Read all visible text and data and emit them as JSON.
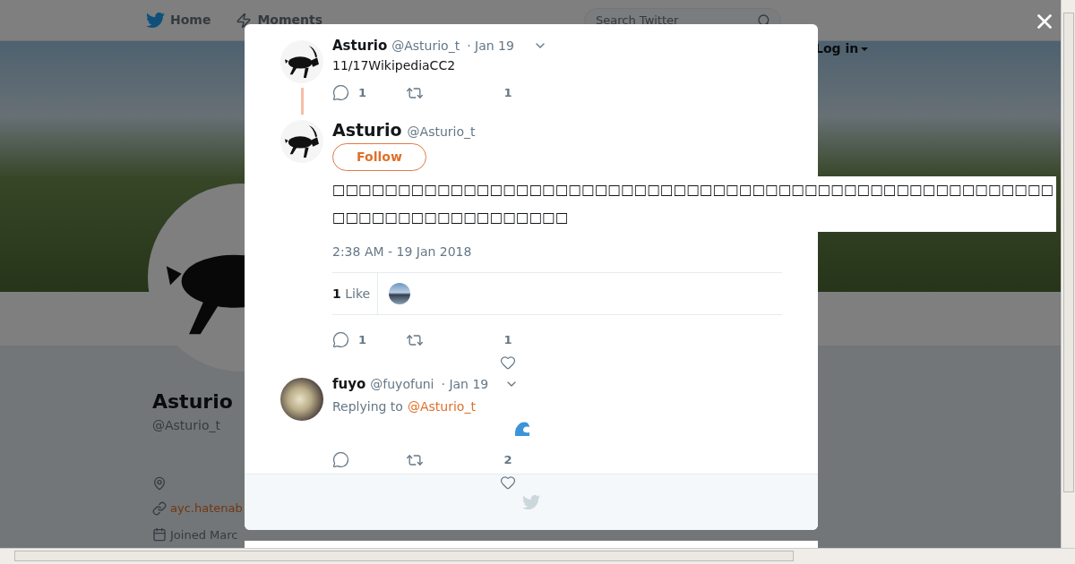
{
  "nav": {
    "links": [
      {
        "label": "Home",
        "kind": "home"
      },
      {
        "label": "Moments",
        "kind": "moments"
      }
    ],
    "search": {
      "placeholder": "Search Twitter"
    },
    "login": "Log in"
  },
  "profile": {
    "name": "Asturio",
    "handle": "@Asturio_t",
    "link": "ayc.hatenab",
    "joined": "Joined Marc"
  },
  "tweets": [
    {
      "kind": "ancestor",
      "name": "Asturio",
      "handle": "@Asturio_t",
      "date": "· Jan 19",
      "text": "11/17WikipediaCC2",
      "replies": "1",
      "likes": "1"
    },
    {
      "kind": "focus",
      "name": "Asturio",
      "handle": "@Asturio_t",
      "follow": "Follow",
      "text": "□□□□□□□□□□□□□□□□□□□□□□□□□□□□□□□□□□□□□□□□□□□□□□□□□□□□□□□□□□□□□□□□□□□□□□□□□",
      "timestamp": "2:38 AM - 19 Jan 2018",
      "like_count": "1",
      "like_label": "Like",
      "replies": "1",
      "likes": "1"
    },
    {
      "kind": "reply",
      "name": "fuyo",
      "handle": "@fuyofuni",
      "date": "· Jan 19",
      "replying_label": "Replying to",
      "replying_to": "@Asturio_t",
      "likes": "2"
    }
  ]
}
